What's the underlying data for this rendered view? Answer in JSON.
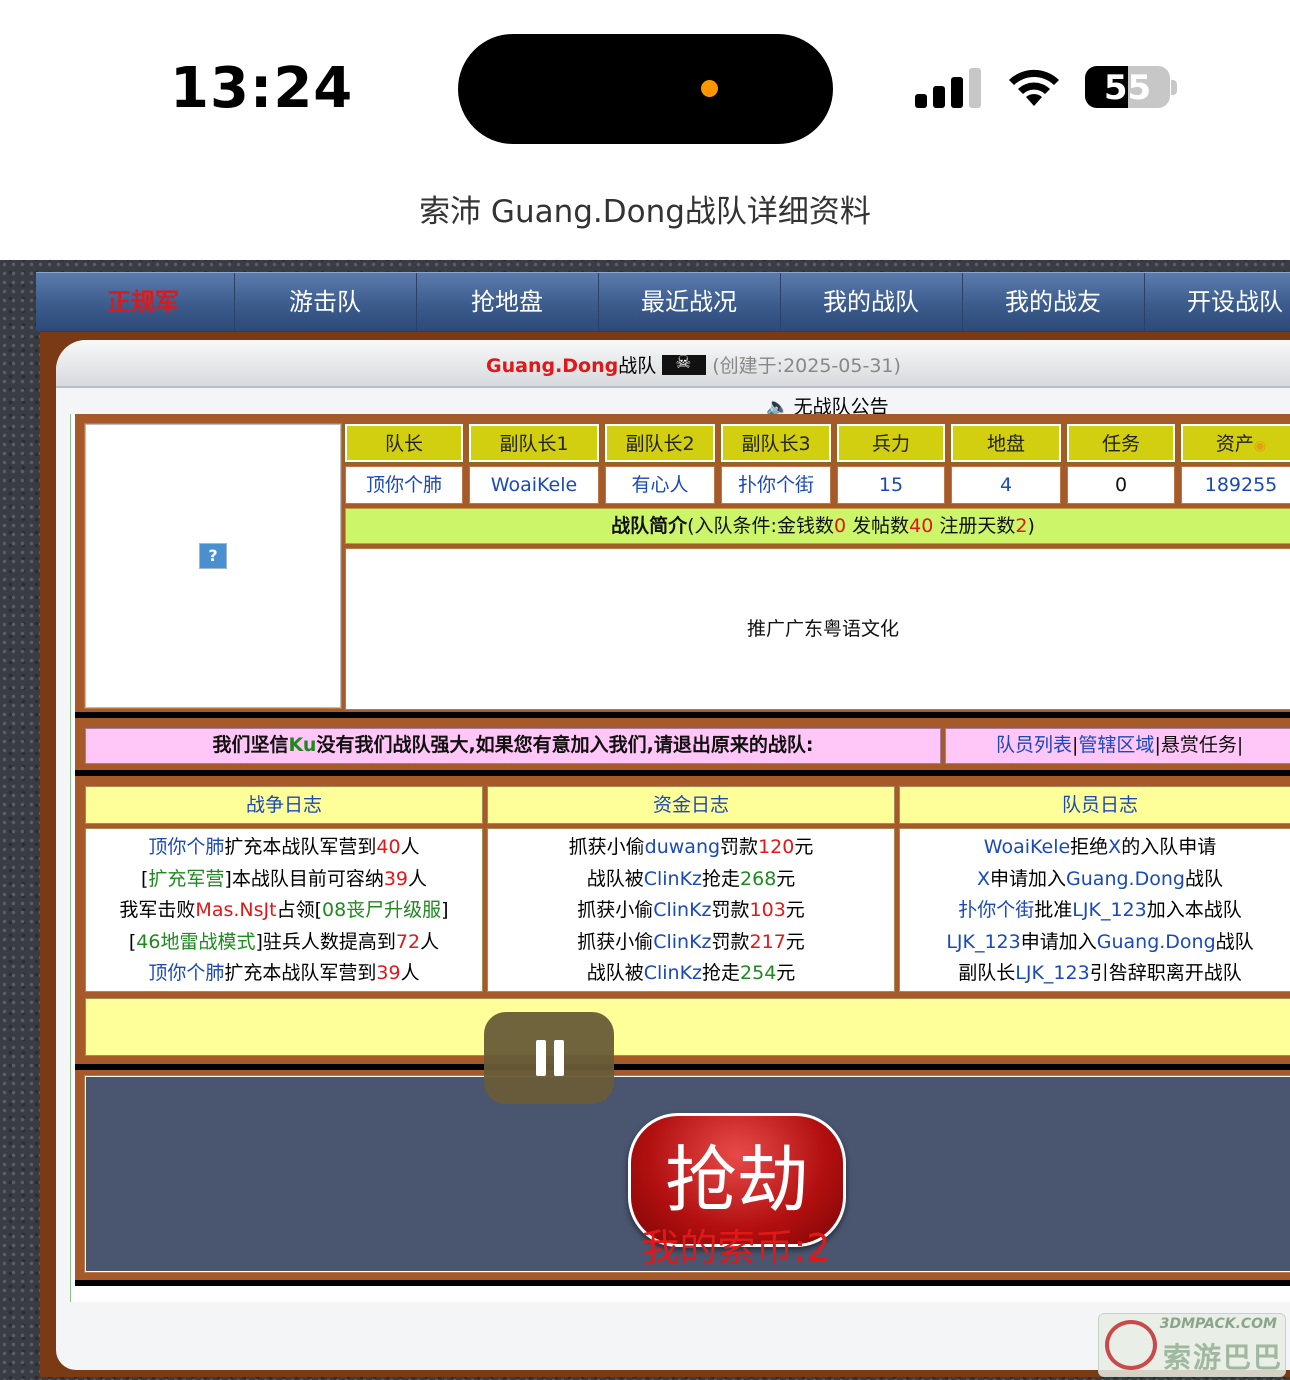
{
  "status_bar": {
    "time": "13:24",
    "battery": "55"
  },
  "page_title": "索沛 Guang.Dong战队详细资料",
  "nav": [
    "正规军",
    "游击队",
    "抢地盘",
    "最近战况",
    "我的战队",
    "我的战友",
    "开设战队"
  ],
  "header": {
    "team_name": "Guang.Dong",
    "team_suffix": "战队",
    "created": "(创建于:2025-05-31)",
    "notice": "无战队公告"
  },
  "stats": {
    "headers": [
      "队长",
      "副队长1",
      "副队长2",
      "副队长3",
      "兵力",
      "地盘",
      "任务",
      "资产"
    ],
    "values": [
      "顶你个肺",
      "WoaiKele",
      "有心人",
      "扑你个街",
      "15",
      "4",
      "0",
      "189255"
    ]
  },
  "intro": {
    "label": "战队简介",
    "cond_prefix": "(入队条件:金钱数",
    "money": "0",
    "posts_label": " 发帖数",
    "posts": "40",
    "days_label": " 注册天数",
    "days": "2",
    "close": ")",
    "text": "推广广东粤语文化"
  },
  "slogan": {
    "pre": "我们坚信",
    "ku": "Ku",
    "post": "没有我们战队强大,如果您有意加入我们,请退出原来的战队:"
  },
  "links": {
    "members": "队员列表",
    "area": "管辖区域",
    "bounty": "悬赏任务"
  },
  "logs": {
    "war_title": "战争日志",
    "money_title": "资金日志",
    "member_title": "队员日志",
    "war": [
      [
        "顶你个肺",
        "扩充本战队军营到",
        "40",
        "人"
      ],
      [
        "[",
        "扩充军营",
        "]本战队目前可容纳",
        "39",
        "人"
      ],
      [
        "我军击败",
        "Mas.NsJt",
        "占领[",
        "08丧尸升级服",
        "]"
      ],
      [
        "[",
        "46地雷战模式",
        "]驻兵人数提高到",
        "72",
        "人"
      ],
      [
        "顶你个肺",
        "扩充本战队军营到",
        "39",
        "人"
      ]
    ],
    "money": [
      [
        "抓获小偷",
        "duwang",
        "罚款",
        "120",
        "元"
      ],
      [
        "战队被",
        "ClinKz",
        "抢走",
        "268",
        "元"
      ],
      [
        "抓获小偷",
        "ClinKz",
        "罚款",
        "103",
        "元"
      ],
      [
        "抓获小偷",
        "ClinKz",
        "罚款",
        "217",
        "元"
      ],
      [
        "战队被",
        "ClinKz",
        "抢走",
        "254",
        "元"
      ]
    ],
    "member": [
      [
        "WoaiKele",
        "拒绝",
        "X",
        "的入队申请"
      ],
      [
        "X",
        "申请加入",
        "Guang.Dong",
        "战队"
      ],
      [
        "扑你个街",
        "批准",
        "LJK_123",
        "加入本战队"
      ],
      [
        "LJK_123",
        "申请加入",
        "Guang.Dong",
        "战队"
      ],
      [
        "副队长",
        "LJK_123",
        "引咎辞职离开战队"
      ]
    ]
  },
  "rob": {
    "label": "抢劫",
    "coins": "我的索币:2"
  },
  "watermark": {
    "site": "3DMPACK.COM",
    "name": "索游巴巴"
  },
  "colors": {
    "nav_bg": "#3b5c8d",
    "frame": "#7a3a14",
    "header_cell": "#d2cf10",
    "intro_bg": "#ccf56a",
    "pink_bar": "#ffc6f7",
    "log_head": "#ffff99",
    "rob": "#b10f0f"
  }
}
